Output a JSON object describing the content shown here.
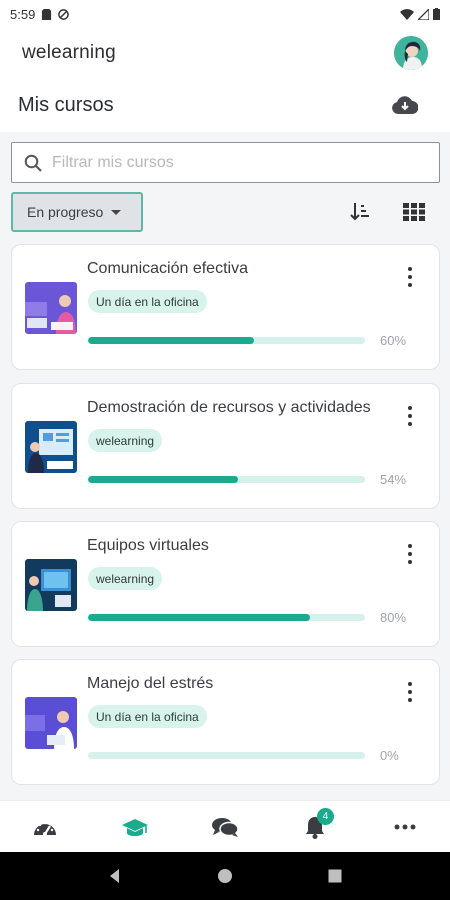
{
  "status_bar": {
    "time": "5:59"
  },
  "app": {
    "title": "welearning"
  },
  "header": {
    "title": "Mis cursos"
  },
  "search": {
    "placeholder": "Filtrar mis cursos",
    "value": ""
  },
  "filter": {
    "selected": "En progreso"
  },
  "courses": [
    {
      "title": "Comunicación efectiva",
      "tag": "Un día en la oficina",
      "progress": 60,
      "progress_label": "60%"
    },
    {
      "title": "Demostración de recursos y actividades",
      "tag": "welearning",
      "progress": 54,
      "progress_label": "54%"
    },
    {
      "title": "Equipos virtuales",
      "tag": "welearning",
      "progress": 80,
      "progress_label": "80%"
    },
    {
      "title": "Manejo del estrés",
      "tag": "Un día en la oficina",
      "progress": 0,
      "progress_label": "0%"
    }
  ],
  "bottom_nav": {
    "notifications_badge": "4"
  },
  "colors": {
    "accent": "#1aab8f",
    "accent_light": "#d6f1ec",
    "tag_bg": "#d8f3ec"
  }
}
